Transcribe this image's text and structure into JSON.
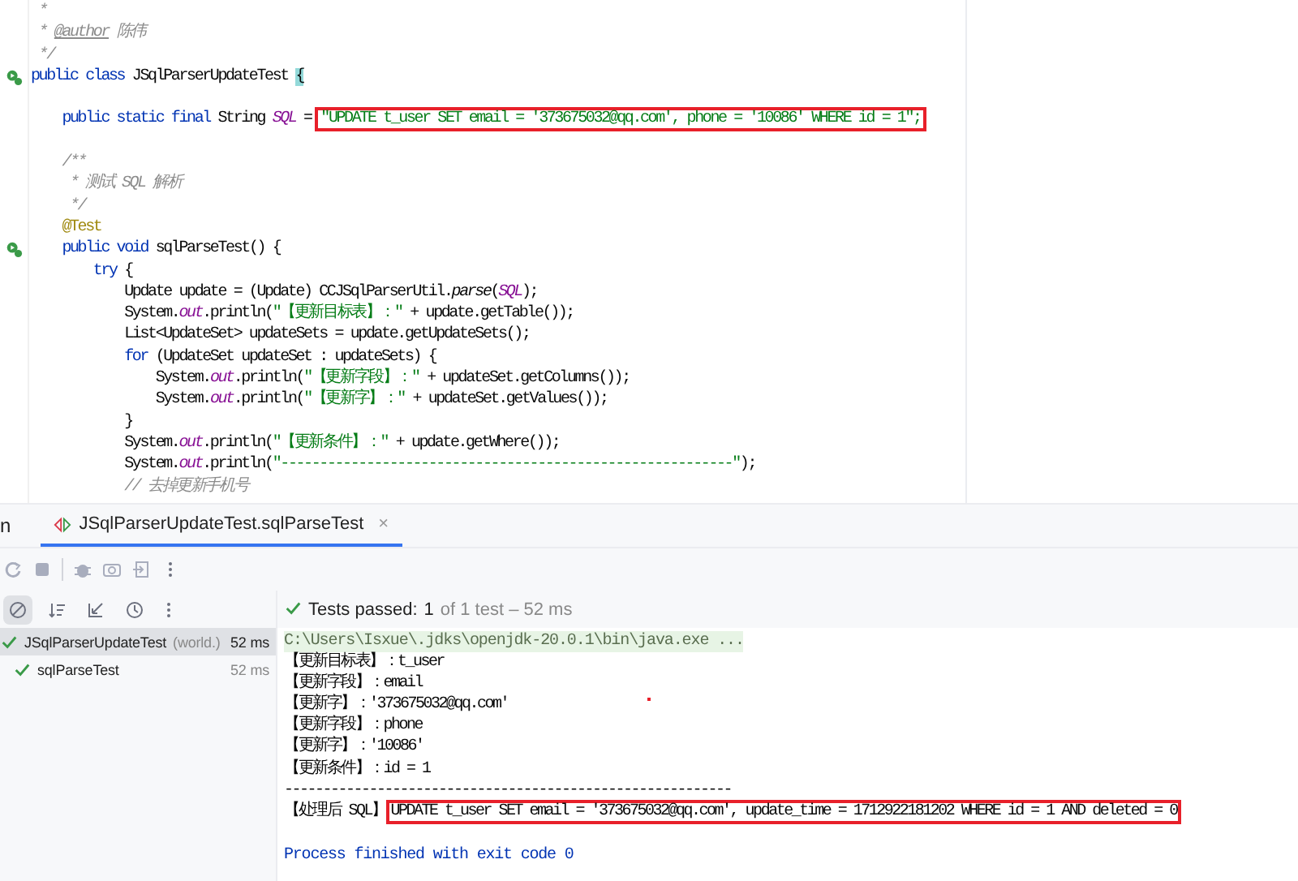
{
  "editor": {
    "lines": [
      {
        "run_icon": false,
        "segments": [
          {
            "text": " *",
            "kind": "comment"
          }
        ]
      },
      {
        "run_icon": false,
        "segments": [
          {
            "text": " * ",
            "kind": "comment"
          },
          {
            "text": "@author",
            "kind": "doc_tag"
          },
          {
            "text": " 陈伟",
            "kind": "comment"
          }
        ]
      },
      {
        "run_icon": false,
        "segments": [
          {
            "text": " */",
            "kind": "comment"
          }
        ]
      },
      {
        "run_icon": true,
        "segments": [
          {
            "text": "public class ",
            "kind": "keyword"
          },
          {
            "text": "JSqlParserUpdateTest ",
            "kind": "plain"
          },
          {
            "text": "{",
            "kind": "matched_brace"
          }
        ]
      },
      {
        "run_icon": false
      },
      {
        "run_icon": false,
        "segments": [
          {
            "text": "    public static final ",
            "kind": "keyword"
          },
          {
            "text": "String ",
            "kind": "plain"
          },
          {
            "text": "SQL",
            "kind": "field"
          },
          {
            "text": " = ",
            "kind": "plain"
          },
          {
            "text": "\"UPDATE t_user SET email = '373675032@qq.com', phone = '10086' WHERE id = 1\";",
            "kind": "string",
            "highlighted": true
          }
        ]
      },
      {
        "run_icon": false
      },
      {
        "run_icon": false,
        "segments": [
          {
            "text": "    /**",
            "kind": "comment"
          }
        ]
      },
      {
        "run_icon": false,
        "segments": [
          {
            "text": "     * 测试 SQL 解析",
            "kind": "comment"
          }
        ]
      },
      {
        "run_icon": false,
        "segments": [
          {
            "text": "     */",
            "kind": "comment"
          }
        ]
      },
      {
        "run_icon": false,
        "segments": [
          {
            "text": "    @Test",
            "kind": "annotation"
          }
        ]
      },
      {
        "run_icon": true,
        "segments": [
          {
            "text": "    public void ",
            "kind": "keyword"
          },
          {
            "text": "sqlParseTest() {",
            "kind": "plain"
          }
        ]
      },
      {
        "run_icon": false,
        "segments": [
          {
            "text": "        try ",
            "kind": "keyword"
          },
          {
            "text": "{",
            "kind": "plain"
          }
        ]
      },
      {
        "run_icon": false,
        "segments": [
          {
            "text": "            Update update = (Update) CCJSqlParserUtil.",
            "kind": "plain"
          },
          {
            "text": "parse",
            "kind": "static_method"
          },
          {
            "text": "(",
            "kind": "plain"
          },
          {
            "text": "SQL",
            "kind": "field"
          },
          {
            "text": ");",
            "kind": "plain"
          }
        ]
      },
      {
        "run_icon": false,
        "segments": [
          {
            "text": "            System.",
            "kind": "plain"
          },
          {
            "text": "out",
            "kind": "field"
          },
          {
            "text": ".println(",
            "kind": "plain"
          },
          {
            "text": "\"【更新目标表】：\"",
            "kind": "string"
          },
          {
            "text": " + update.getTable());",
            "kind": "plain"
          }
        ]
      },
      {
        "run_icon": false,
        "segments": [
          {
            "text": "            List<UpdateSet> updateSets = update.getUpdateSets();",
            "kind": "plain"
          }
        ]
      },
      {
        "run_icon": false,
        "segments": [
          {
            "text": "            for ",
            "kind": "keyword"
          },
          {
            "text": "(UpdateSet updateSet : updateSets) {",
            "kind": "plain"
          }
        ]
      },
      {
        "run_icon": false,
        "segments": [
          {
            "text": "                System.",
            "kind": "plain"
          },
          {
            "text": "out",
            "kind": "field"
          },
          {
            "text": ".println(",
            "kind": "plain"
          },
          {
            "text": "\"【更新字段】：\"",
            "kind": "string"
          },
          {
            "text": " + updateSet.getColumns());",
            "kind": "plain"
          }
        ]
      },
      {
        "run_icon": false,
        "segments": [
          {
            "text": "                System.",
            "kind": "plain"
          },
          {
            "text": "out",
            "kind": "field"
          },
          {
            "text": ".println(",
            "kind": "plain"
          },
          {
            "text": "\"【更新字】：\"",
            "kind": "string"
          },
          {
            "text": " + updateSet.getValues());",
            "kind": "plain"
          }
        ]
      },
      {
        "run_icon": false,
        "segments": [
          {
            "text": "            }",
            "kind": "plain"
          }
        ]
      },
      {
        "run_icon": false,
        "segments": [
          {
            "text": "            System.",
            "kind": "plain"
          },
          {
            "text": "out",
            "kind": "field"
          },
          {
            "text": ".println(",
            "kind": "plain"
          },
          {
            "text": "\"【更新条件】：\"",
            "kind": "string"
          },
          {
            "text": " + update.getWhere());",
            "kind": "plain"
          }
        ]
      },
      {
        "run_icon": false,
        "segments": [
          {
            "text": "            System.",
            "kind": "plain"
          },
          {
            "text": "out",
            "kind": "field"
          },
          {
            "text": ".println(",
            "kind": "plain"
          },
          {
            "text": "\"----------------------------------------------------------\"",
            "kind": "string"
          },
          {
            "text": ");",
            "kind": "plain"
          }
        ]
      },
      {
        "run_icon": false,
        "segments": [
          {
            "text": "            // 去掉更新手机号",
            "kind": "comment"
          }
        ]
      }
    ]
  },
  "run_panel": {
    "tool_window_label": "n",
    "tabs": [
      {
        "label": "JSqlParserUpdateTest.sqlParseTest",
        "close": "×",
        "selected": true
      }
    ],
    "filter_buttons": [
      {
        "kind": "show-passed",
        "selected": true
      },
      {
        "kind": "sort",
        "selected": false
      },
      {
        "kind": "collapse",
        "selected": false
      },
      {
        "kind": "history",
        "selected": false
      }
    ],
    "status": {
      "passed": true,
      "label": "Tests passed:",
      "count": "1",
      "detail": "of 1 test – 52 ms"
    },
    "tree": [
      {
        "name": "JSqlParserUpdateTest",
        "location": "(world.)",
        "duration": "52 ms",
        "passed": true,
        "selected": true,
        "children": [
          {
            "name": "sqlParseTest",
            "duration": "52 ms",
            "passed": true,
            "selected": false
          }
        ]
      }
    ],
    "console": [
      {
        "kind": "command",
        "segments": [
          {
            "text": "C:\\Users\\Isxue\\.jdks\\openjdk-20.0.1\\bin\\java.exe ..."
          }
        ]
      },
      {
        "kind": "output",
        "segments": [
          {
            "text": "【更新目标表】：t_user"
          }
        ]
      },
      {
        "kind": "output",
        "segments": [
          {
            "text": "【更新字段】：email"
          }
        ]
      },
      {
        "kind": "output",
        "segments": [
          {
            "text": "【更新字】：'373675032@qq.com'"
          }
        ]
      },
      {
        "kind": "output",
        "segments": [
          {
            "text": "【更新字段】：phone"
          }
        ]
      },
      {
        "kind": "output",
        "segments": [
          {
            "text": "【更新字】：'10086'"
          }
        ]
      },
      {
        "kind": "output",
        "segments": [
          {
            "text": "【更新条件】：id = 1"
          }
        ]
      },
      {
        "kind": "output",
        "segments": [
          {
            "text": "----------------------------------------------------------"
          }
        ]
      },
      {
        "kind": "output",
        "segments": [
          {
            "text": "【处理后 SQL】"
          },
          {
            "text": "UPDATE t_user SET email = '373675032@qq.com', update_time = 1712922181202 WHERE id = 1 AND deleted = 0",
            "highlighted": true
          }
        ]
      },
      {
        "kind": "blank"
      },
      {
        "kind": "exit",
        "segments": [
          {
            "text": "Process finished with exit code 0"
          }
        ]
      }
    ]
  }
}
